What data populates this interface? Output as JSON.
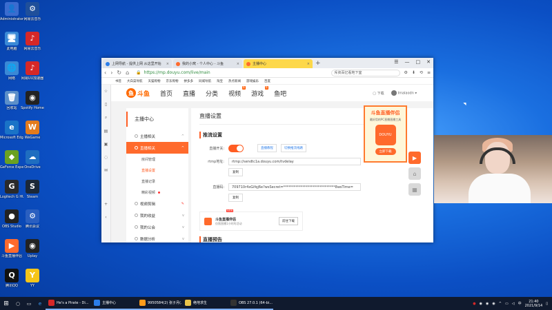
{
  "desktop_icons": [
    {
      "label": "Administrator",
      "color": "#3b6ccf",
      "glyph": "👤"
    },
    {
      "label": "网易云音乐",
      "color": "#1f4f9a",
      "glyph": "⚙"
    },
    {
      "label": "此电脑",
      "color": "#3a89d6",
      "glyph": "🖥"
    },
    {
      "label": "网易云音乐",
      "color": "#d62828",
      "glyph": "♪"
    },
    {
      "label": "网络",
      "color": "#3a89d6",
      "glyph": "🌐"
    },
    {
      "label": "网易UU加速器",
      "color": "#d62828",
      "glyph": "♪"
    },
    {
      "label": "回收站",
      "color": "#5b8fc9",
      "glyph": "🗑"
    },
    {
      "label": "Spotify Home",
      "color": "#222",
      "glyph": "◉"
    },
    {
      "label": "Microsoft Edge",
      "color": "#1a73c7",
      "glyph": "e"
    },
    {
      "label": "WeGame",
      "color": "#e47b1d",
      "glyph": "W"
    },
    {
      "label": "GeForce Experience",
      "color": "#6aa121",
      "glyph": "◆"
    },
    {
      "label": "OneDrive",
      "color": "#1f6ec0",
      "glyph": "☁"
    },
    {
      "label": "Logitech G HUB",
      "color": "#2a2a2a",
      "glyph": "G"
    },
    {
      "label": "Steam",
      "color": "#1b2838",
      "glyph": "S"
    },
    {
      "label": "OBS Studio",
      "color": "#222",
      "glyph": "●"
    },
    {
      "label": "腾讯会议",
      "color": "#2a5fc0",
      "glyph": "⚙"
    },
    {
      "label": "斗鱼直播伴侣",
      "color": "#ff6a2c",
      "glyph": "▶"
    },
    {
      "label": "Uplay",
      "color": "#222",
      "glyph": "◉"
    },
    {
      "label": "腾讯QQ",
      "color": "#111",
      "glyph": "Q"
    },
    {
      "label": "YY",
      "color": "#f5c518",
      "glyph": "Y"
    }
  ],
  "browser": {
    "tabs": [
      {
        "label": "上网导航 - 提供上网 从这里开始",
        "active": false
      },
      {
        "label": "我的小窝 - 个人中心 - 斗鱼",
        "active": false
      },
      {
        "label": "主播中心",
        "active": true
      }
    ],
    "url": "https://mp.douyu.com/live/main",
    "search_text": "斥资百亿看地下室",
    "favorites": [
      "书签",
      "大白菜导航",
      "天猫购物",
      "京东购物",
      "拼多多",
      "同城导航",
      "淘宝",
      "热点新闻",
      "游戏娱乐",
      "百度"
    ]
  },
  "header": {
    "logo": "斗鱼",
    "nav": [
      "首页",
      "直播",
      "分类",
      "视频",
      "游戏",
      "鱼吧"
    ],
    "nav_hot": {
      "3": "热",
      "4": "热"
    },
    "download": "下载",
    "username": "Imalaodn"
  },
  "menu": {
    "title": "主播中心",
    "sections": [
      {
        "label": "主播相关",
        "active": false
      },
      {
        "label": "直播相关",
        "active": true
      }
    ],
    "subs": [
      "房间管理",
      "直播设置",
      "直播记录",
      "精彩视频"
    ],
    "after": [
      "视频剪辑",
      "我的收益",
      "我的公会",
      "数据分析"
    ]
  },
  "main": {
    "page_title": "直播设置",
    "section_push": "推流设置",
    "switch_label": "直播开关:",
    "btn_tutorial": "直播教程",
    "btn_line": "切换推流线路",
    "rtmp_label": "rtmp地址:",
    "rtmp_value": "rtmp://sendtc1a.douyu.com/tvdelay",
    "copy1": "复制",
    "code_label": "直播码:",
    "code_value": "709710r4xGifqj6e?wsSecret=******************************8wsTime=",
    "copy2": "复制",
    "helper_title": "斗鱼直播伴侣",
    "helper_sub": "仅限直播1小时的活动",
    "helper_new": "NEW",
    "helper_btn": "前往下载",
    "section_notice": "直播预告"
  },
  "ad": {
    "title": "斗鱼直播伴侣",
    "sub": "最好用的PC直播直播工具",
    "logo": "DOUYU",
    "button": "立即下载"
  },
  "taskbar": {
    "apps": [
      {
        "label": "He's a Pirate - Di...",
        "color": "#d62828"
      },
      {
        "label": "主播中心",
        "color": "#2b7de9"
      },
      {
        "label": "9950584(2) 张子月(...",
        "color": "#ff9b1a"
      },
      {
        "label": "绝地求生",
        "color": "#e8c34a"
      },
      {
        "label": "OBS 27.0.1 (64-bi...",
        "color": "#333"
      }
    ],
    "time": "21:40",
    "date": "2021/9/14"
  }
}
